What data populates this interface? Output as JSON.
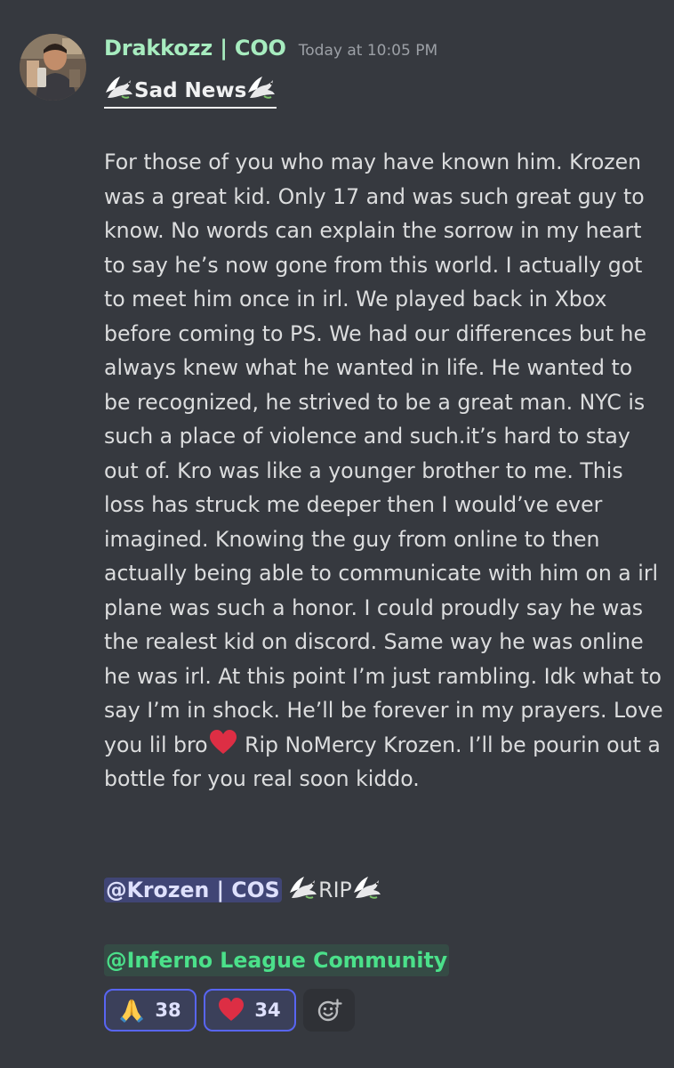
{
  "message": {
    "username": "Drakkozz | COO",
    "timestamp": "Today at 10:05 PM",
    "title": "Sad News",
    "body": "For those of you who may have known him. Krozen was a great kid. Only 17 and was such great guy to know. No words can explain the sorrow in my heart to say he’s now gone from this world. I actually got to meet him once in irl. We played back in Xbox before coming to PS. We had our differences but he always knew what he wanted in life. He wanted to be recognized, he strived to be a great man. NYC is such a place of violence and such.it’s hard to stay out of. Kro was like a younger brother to me. This loss has struck me deeper then I would’ve ever imagined. Knowing the guy from online to then actually being able to communicate with him on a irl plane was such a honor. I could proudly say he was the realest kid on discord. Same way he was online he was irl. At this point I’m just rambling. Idk what to say I’m in shock. He’ll be forever in my prayers. Love you lil bro",
    "body_after_heart": "Rip NoMercy Krozen. I’ll be pourin out a bottle for you real soon kiddo.",
    "user_mention": "@Krozen | COS",
    "rip_text": "RIP",
    "role_mention": "@Inferno League Community"
  },
  "reactions": [
    {
      "emoji": "folded-hands-icon",
      "count": "38"
    },
    {
      "emoji": "red-heart-icon",
      "count": "34"
    }
  ],
  "colors": {
    "background": "#36393f",
    "username": "#a7ecbf",
    "mention_bg": "#4a508f",
    "role_mention_text": "#4be08a",
    "reaction_border": "#5865f2"
  }
}
